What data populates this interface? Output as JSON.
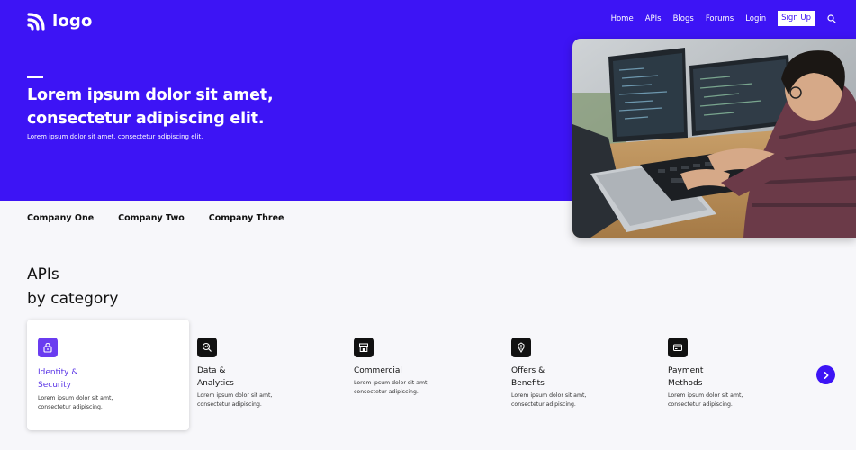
{
  "header": {
    "logo_text": "logo",
    "nav": [
      "Home",
      "APIs",
      "Blogs",
      "Forums",
      "Login"
    ],
    "signup_label": "Sign Up"
  },
  "hero": {
    "title_line1": "Lorem ipsum dolor sit amet,",
    "title_line2": "consectetur adipiscing elit.",
    "subtitle": "Lorem ipsum dolor sit amet, consectetur adipiscing elit."
  },
  "companies": [
    "Company One",
    "Company Two",
    "Company Three"
  ],
  "apis": {
    "heading_line1": "APIs",
    "heading_line2": "by category",
    "categories": [
      {
        "title_line1": "Identity &",
        "title_line2": "Security",
        "desc_line1": "Lorem ipsum dolor sit amt,",
        "desc_line2": "consectetur adipiscing.",
        "icon": "lock-icon",
        "active": true
      },
      {
        "title_line1": "Data &",
        "title_line2": "Analytics",
        "desc_line1": "Lorem ipsum dolor sit amt,",
        "desc_line2": "consectetur adipiscing.",
        "icon": "analytics-icon",
        "active": false
      },
      {
        "title_line1": "Commercial",
        "title_line2": "",
        "desc_line1": "Lorem ipsum dolor sit amt,",
        "desc_line2": "consectetur adipiscing.",
        "icon": "store-icon",
        "active": false
      },
      {
        "title_line1": "Offers &",
        "title_line2": "Benefits",
        "desc_line1": "Lorem ipsum dolor sit amt,",
        "desc_line2": "consectetur adipiscing.",
        "icon": "tag-icon",
        "active": false
      },
      {
        "title_line1": "Payment",
        "title_line2": "Methods",
        "desc_line1": "Lorem ipsum dolor sit amt,",
        "desc_line2": "consectetur adipiscing.",
        "icon": "credit-card-icon",
        "active": false
      }
    ]
  },
  "colors": {
    "brand": "#3d14f5",
    "accent": "#6a3cf0",
    "background": "#f7f7fa"
  }
}
